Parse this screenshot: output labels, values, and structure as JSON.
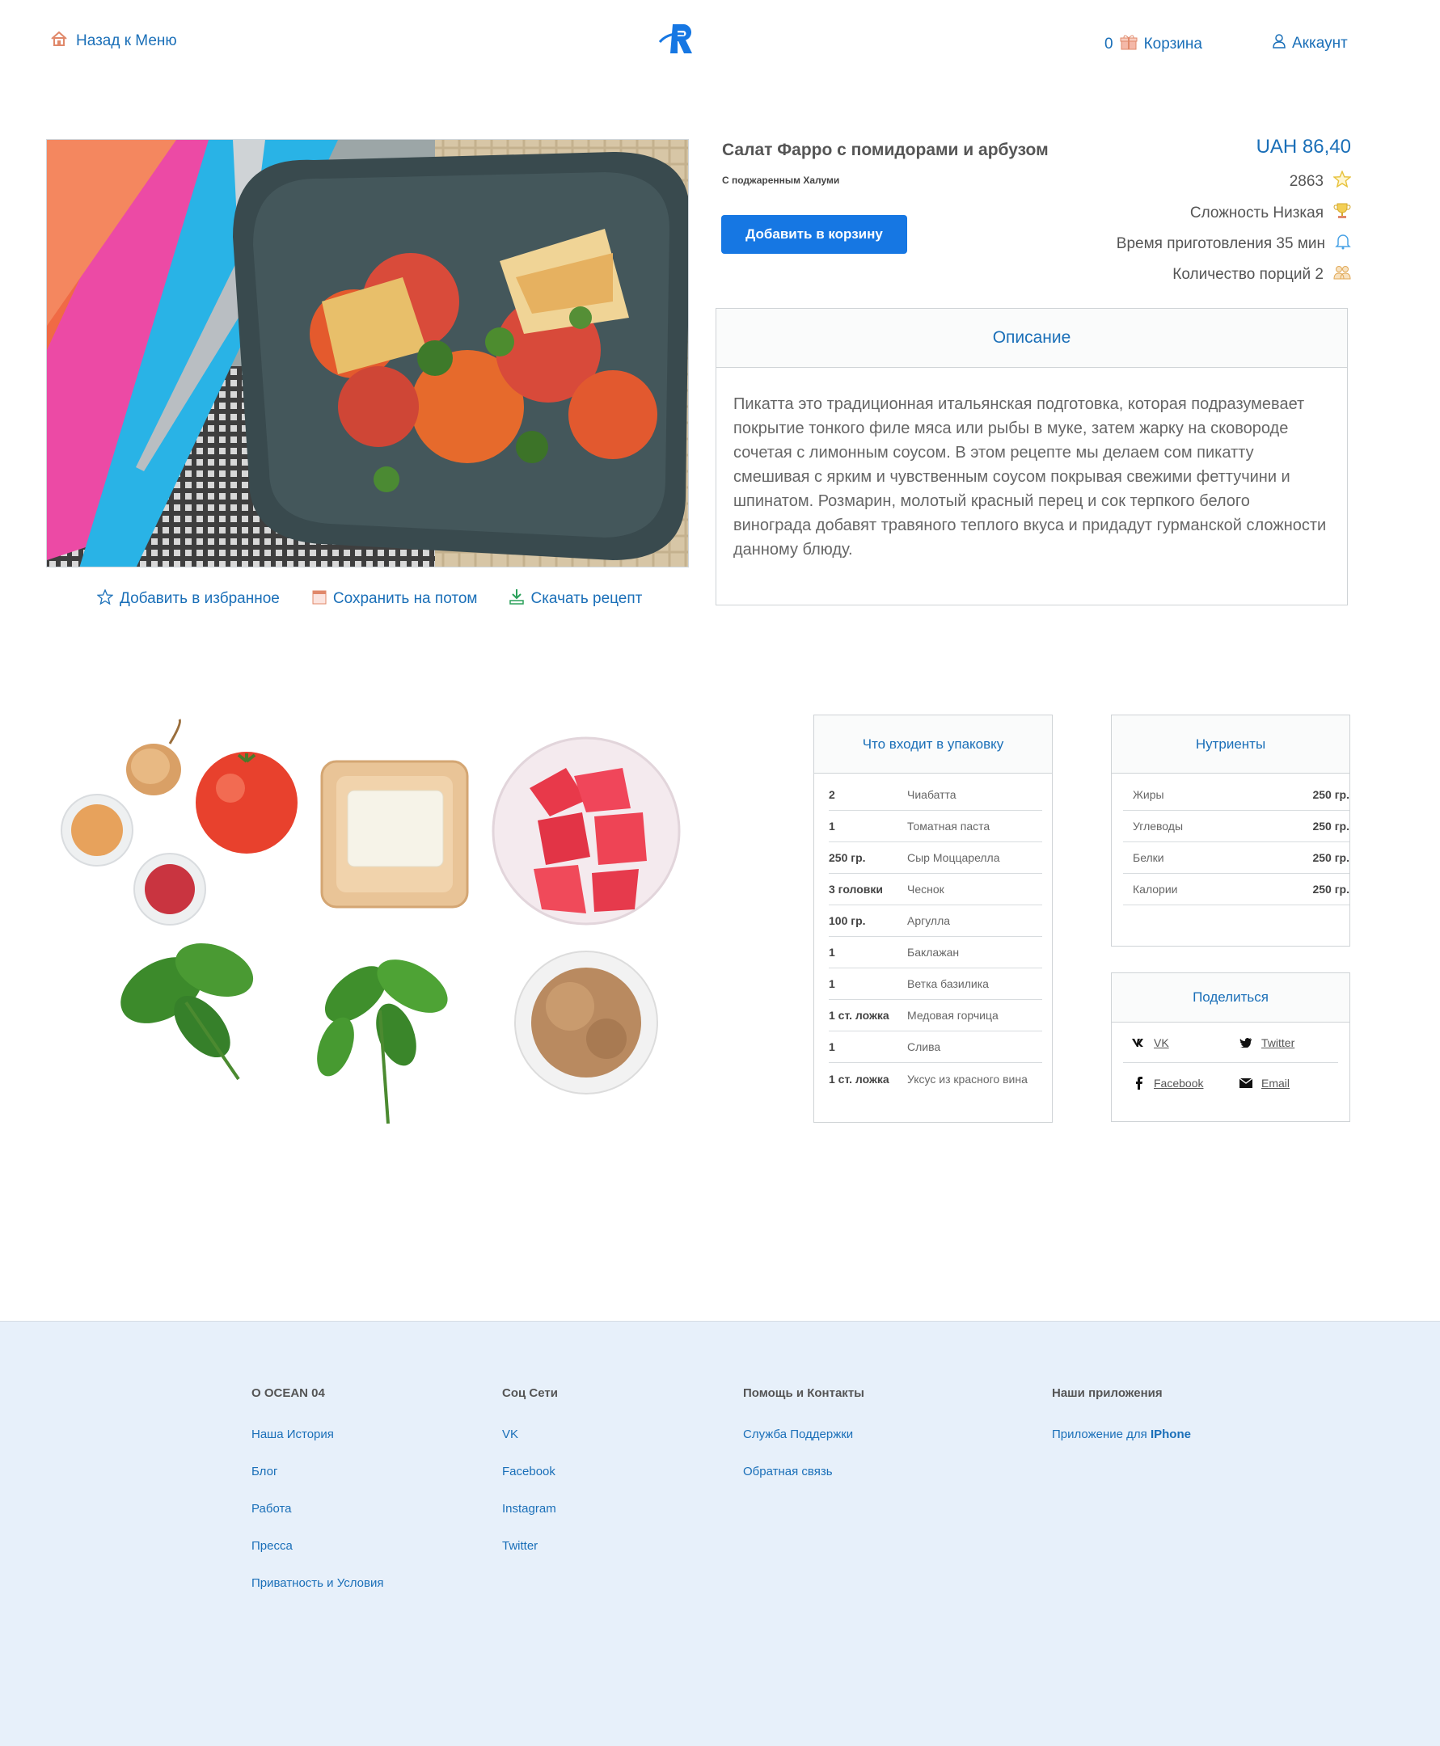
{
  "header": {
    "back_label": "Назад к Меню",
    "cart_count": "0",
    "cart_label": "Корзина",
    "account_label": "Аккаунт",
    "logo_letter": "R"
  },
  "product": {
    "title": "Салат Фарро с помидорами и арбузом",
    "subtitle": "С поджаренным Халуми",
    "add_to_cart": "Добавить в корзину",
    "price": "UAH 86,40",
    "rating": "2863",
    "difficulty": "Сложность Низкая",
    "cook_time": "Время приготовления 35 мин",
    "servings": "Количество порций 2"
  },
  "actions": {
    "favorite": "Добавить в избранное",
    "save_later": "Сохранить на потом",
    "download": "Скачать рецепт"
  },
  "description": {
    "heading": "Описание",
    "text": "Пикатта это традиционная итальянская подготовка, которая подразумевает покрытие тонкого филе мяса или рыбы в муке, затем жарку на сковороде сочетая с лимонным соусом. В этом рецепте мы делаем сом пикатту смешивая с ярким и чувственным соусом покрывая свежими феттучини и шпинатом. Розмарин, молотый красный перец и сок терпкого белого винограда добавят травяного теплого вкуса и придадут гурманской сложности данному блюду."
  },
  "package": {
    "heading": "Что входит в упаковку",
    "items": [
      {
        "qty": "2",
        "name": "Чиабатта"
      },
      {
        "qty": "1",
        "name": "Томатная паста"
      },
      {
        "qty": "250 гр.",
        "name": "Сыр Моццарелла"
      },
      {
        "qty": "3 головки",
        "name": "Чеснок"
      },
      {
        "qty": "100 гр.",
        "name": "Аргулла"
      },
      {
        "qty": "1",
        "name": "Баклажан"
      },
      {
        "qty": "1",
        "name": "Ветка базилика"
      },
      {
        "qty": "1 ст. ложка",
        "name": "Медовая горчица"
      },
      {
        "qty": "1",
        "name": "Слива"
      },
      {
        "qty": "1 ст. ложка",
        "name": "Уксус из красного вина"
      }
    ]
  },
  "nutrients": {
    "heading": "Нутриенты",
    "items": [
      {
        "name": "Жиры",
        "value": "250 гр."
      },
      {
        "name": "Углеводы",
        "value": "250 гр."
      },
      {
        "name": "Белки",
        "value": "250 гр."
      },
      {
        "name": "Калории",
        "value": "250 гр."
      }
    ]
  },
  "share": {
    "heading": "Поделиться",
    "vk": "VK",
    "twitter": "Twitter",
    "facebook": "Facebook",
    "email": "Email"
  },
  "footer": {
    "col1": {
      "heading": "О OCEAN 04",
      "links": [
        "Наша История",
        "Блог",
        "Работа",
        "Пресса",
        "Приватность и Условия"
      ]
    },
    "col2": {
      "heading": "Соц Сети",
      "links": [
        "VK",
        "Facebook",
        "Instagram",
        "Twitter"
      ]
    },
    "col3": {
      "heading": "Помощь и Контакты",
      "links": [
        "Служба Поддержки",
        "Обратная связь"
      ]
    },
    "col4": {
      "heading": "Наши приложения",
      "app_prefix": "Приложение для",
      "app_brand": "IPhone"
    }
  },
  "colors": {
    "accent": "#1a6fb8",
    "button": "#1677e3",
    "footer_bg": "#e7f0fa",
    "star": "#e7c23c"
  }
}
